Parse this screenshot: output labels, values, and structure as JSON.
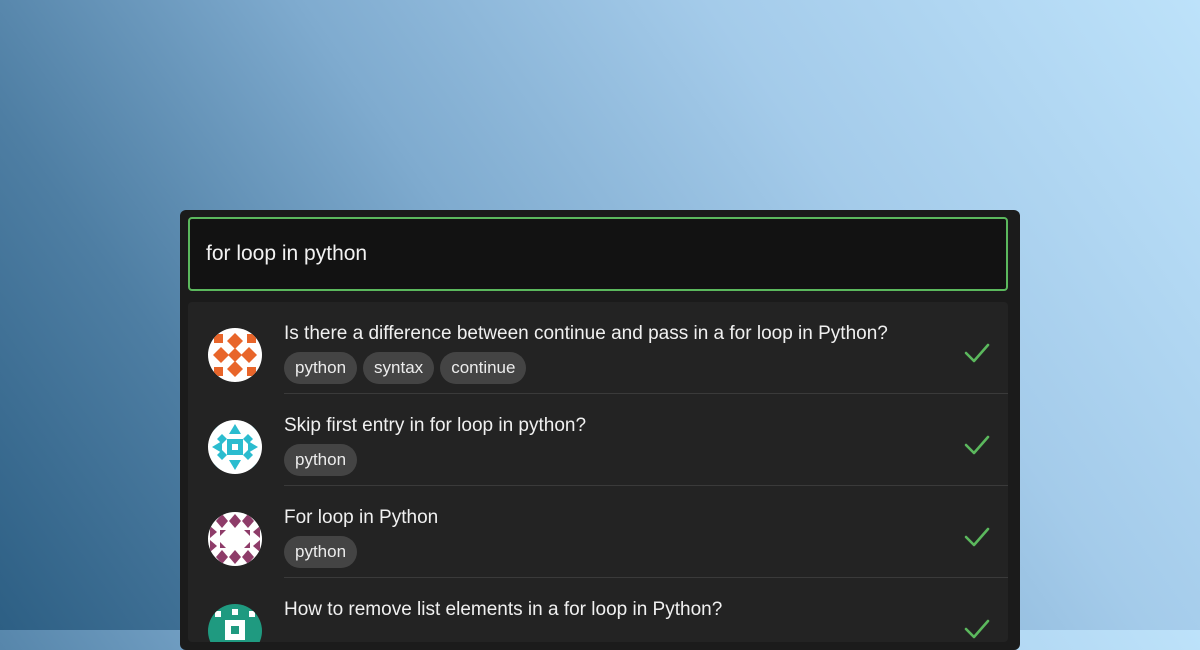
{
  "search": {
    "value": "for loop in python"
  },
  "accent_color": "#5bb85d",
  "results": [
    {
      "title": "Is there a difference between continue and pass in a for loop in Python?",
      "tags": [
        "python",
        "syntax",
        "continue"
      ],
      "avatar_color": "#e8652a",
      "status": "check-icon"
    },
    {
      "title": "Skip first entry in for loop in python?",
      "tags": [
        "python"
      ],
      "avatar_color": "#2bbccf",
      "status": "check-icon"
    },
    {
      "title": "For loop in Python",
      "tags": [
        "python"
      ],
      "avatar_color": "#8e3c69",
      "status": "check-icon"
    },
    {
      "title": "How to remove list elements in a for loop in Python?",
      "tags": [],
      "avatar_color": "#1f9a80",
      "status": "check-icon"
    }
  ]
}
